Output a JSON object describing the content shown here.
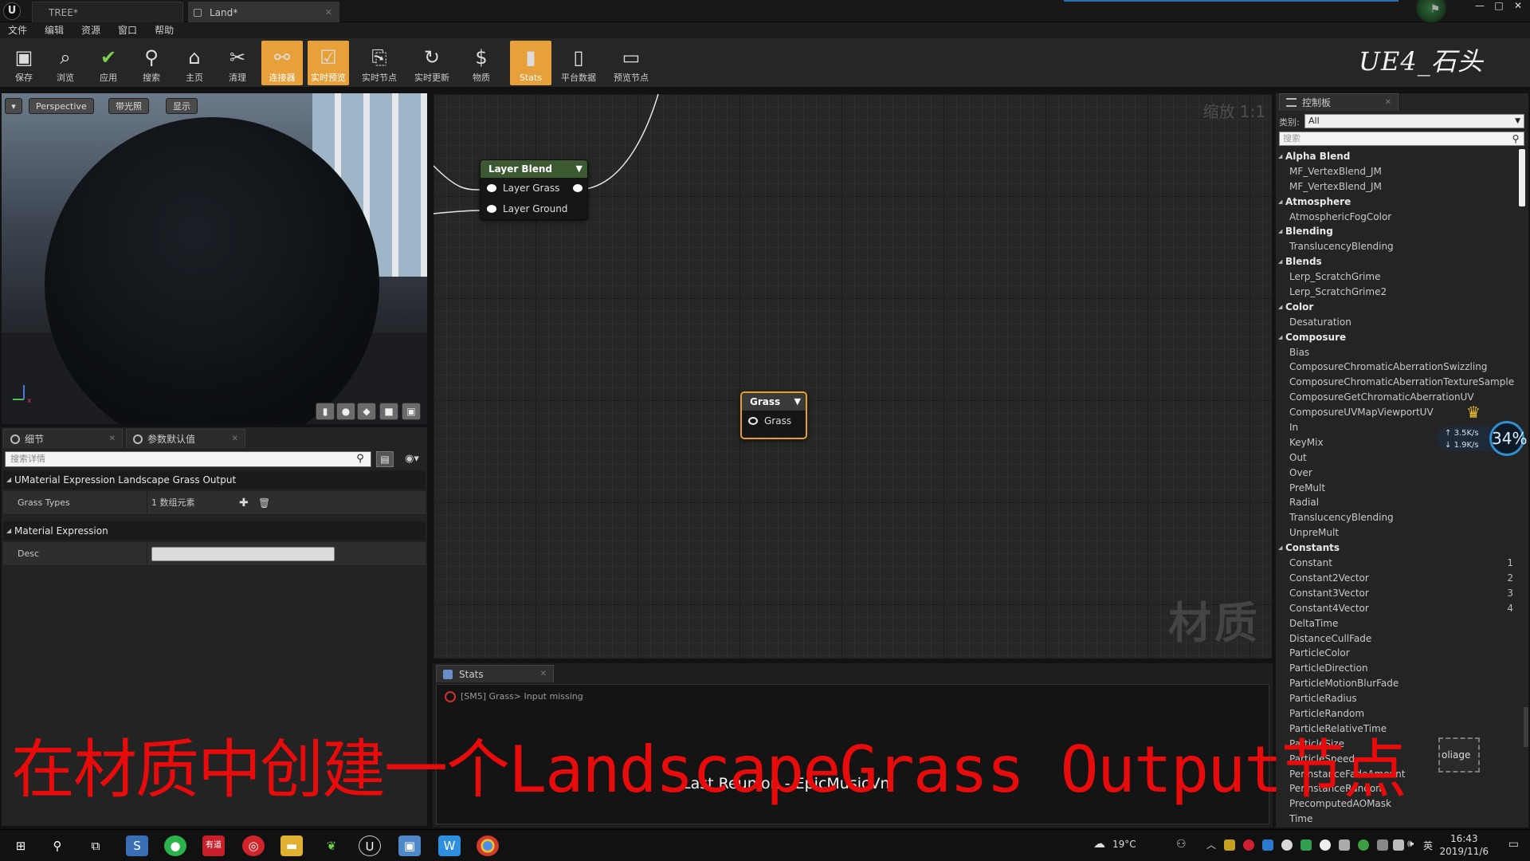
{
  "titlebar": {
    "logo": "U",
    "tabs": [
      {
        "label": "TREE*"
      },
      {
        "label": "Land*"
      }
    ],
    "window_controls": [
      "—",
      "□",
      "✕"
    ]
  },
  "menu": [
    "文件",
    "编辑",
    "资源",
    "窗口",
    "帮助"
  ],
  "toolbar": {
    "buttons": [
      {
        "label": "保存",
        "icon": "save-icon",
        "active": false
      },
      {
        "label": "浏览",
        "icon": "browse-icon",
        "active": false
      },
      {
        "label": "应用",
        "icon": "apply-check-icon",
        "active": false
      },
      {
        "label": "搜索",
        "icon": "search-binoculars-icon",
        "active": false
      },
      {
        "label": "主页",
        "icon": "home-icon",
        "active": false
      },
      {
        "label": "清理",
        "icon": "clean-icon",
        "active": false
      },
      {
        "label": "连接器",
        "icon": "connector-icon",
        "active": true
      },
      {
        "label": "实时预览",
        "icon": "live-preview-icon",
        "active": true
      },
      {
        "label": "实时节点",
        "icon": "live-nodes-icon",
        "active": false
      },
      {
        "label": "实时更新",
        "icon": "live-update-icon",
        "active": false
      },
      {
        "label": "物质",
        "icon": "dollar-icon",
        "active": false
      },
      {
        "label": "Stats",
        "icon": "stats-icon",
        "active": true
      },
      {
        "label": "平台数据",
        "icon": "platform-stats-icon",
        "active": false
      },
      {
        "label": "预览节点",
        "icon": "preview-node-icon",
        "active": false
      }
    ],
    "brand": "UE4_石头"
  },
  "viewport": {
    "perspective": "Perspective",
    "lit": "带光照",
    "show": "显示"
  },
  "details": {
    "tabs": [
      {
        "label": "细节"
      },
      {
        "label": "参数默认值"
      }
    ],
    "search_placeholder": "搜索详情",
    "section1": "UMaterial Expression Landscape Grass Output",
    "grass_types": {
      "name": "Grass Types",
      "value": "1 数组元素"
    },
    "section2": "Material Expression",
    "desc": {
      "name": "Desc",
      "value": ""
    }
  },
  "graph": {
    "zoom": "缩放 1:1",
    "watermark": "材质",
    "nodes": {
      "layer_blend": {
        "title": "Layer Blend",
        "inputs": [
          "Layer Grass",
          "Layer Ground"
        ],
        "color": "#3c5a32"
      },
      "grass": {
        "title": "Grass",
        "inputs": [
          "Grass"
        ],
        "color": "#3a3a3a",
        "border": "#e8a020"
      }
    }
  },
  "stats": {
    "tab": "Stats",
    "error": "[SM5] Grass> Input missing",
    "song": "Last Reunion - EpicMusicVn"
  },
  "palette": {
    "tab": "控制板",
    "category_label": "类别:",
    "category_value": "All",
    "search_placeholder": "搜索",
    "groups": [
      {
        "name": "Alpha Blend",
        "items": [
          {
            "label": "MF_VertexBlend_JM"
          },
          {
            "label": "MF_VertexBlend_JM"
          }
        ]
      },
      {
        "name": "Atmosphere",
        "items": [
          {
            "label": "AtmosphericFogColor"
          }
        ]
      },
      {
        "name": "Blending",
        "items": [
          {
            "label": "TranslucencyBlending"
          }
        ]
      },
      {
        "name": "Blends",
        "items": [
          {
            "label": "Lerp_ScratchGrime"
          },
          {
            "label": "Lerp_ScratchGrime2"
          }
        ]
      },
      {
        "name": "Color",
        "items": [
          {
            "label": "Desaturation"
          }
        ]
      },
      {
        "name": "Composure",
        "items": [
          {
            "label": "Bias"
          },
          {
            "label": "ComposureChromaticAberrationSwizzling"
          },
          {
            "label": "ComposureChromaticAberrationTextureSample"
          },
          {
            "label": "ComposureGetChromaticAberrationUV"
          },
          {
            "label": "ComposureUVMapViewportUV"
          },
          {
            "label": "In"
          },
          {
            "label": "KeyMix"
          },
          {
            "label": "Out"
          },
          {
            "label": "Over"
          },
          {
            "label": "PreMult"
          },
          {
            "label": "Radial"
          },
          {
            "label": "TranslucencyBlending"
          },
          {
            "label": "UnpreMult"
          }
        ]
      },
      {
        "name": "Constants",
        "items": [
          {
            "label": "Constant",
            "shortcut": "1"
          },
          {
            "label": "Constant2Vector",
            "shortcut": "2"
          },
          {
            "label": "Constant3Vector",
            "shortcut": "3"
          },
          {
            "label": "Constant4Vector",
            "shortcut": "4"
          },
          {
            "label": "DeltaTime"
          },
          {
            "label": "DistanceCullFade"
          },
          {
            "label": "ParticleColor"
          },
          {
            "label": "ParticleDirection"
          },
          {
            "label": "ParticleMotionBlurFade"
          },
          {
            "label": "ParticleRadius"
          },
          {
            "label": "ParticleRandom"
          },
          {
            "label": "ParticleRelativeTime"
          },
          {
            "label": "ParticleSize"
          },
          {
            "label": "ParticleSpeed"
          },
          {
            "label": "PerInstanceFadeAmount"
          },
          {
            "label": "PerInstanceRandom"
          },
          {
            "label": "PrecomputedAOMask"
          },
          {
            "label": "Time"
          }
        ]
      }
    ]
  },
  "net_widget": {
    "up": "3.5K/s",
    "down": "1.9K/s",
    "percent": "34%"
  },
  "foliage_badge": "oliage",
  "subtitle": "在材质中创建一个LandscapeGrass Output节点",
  "taskbar": {
    "weather": "19°C",
    "time": "16:43",
    "date": "2019/11/6",
    "ime": "英"
  },
  "colors": {
    "accent_orange": "#e8a13a",
    "subtitle_red": "#e80b0b",
    "layer_blend_header": "#3c5a32",
    "grass_border": "#e8a020"
  }
}
